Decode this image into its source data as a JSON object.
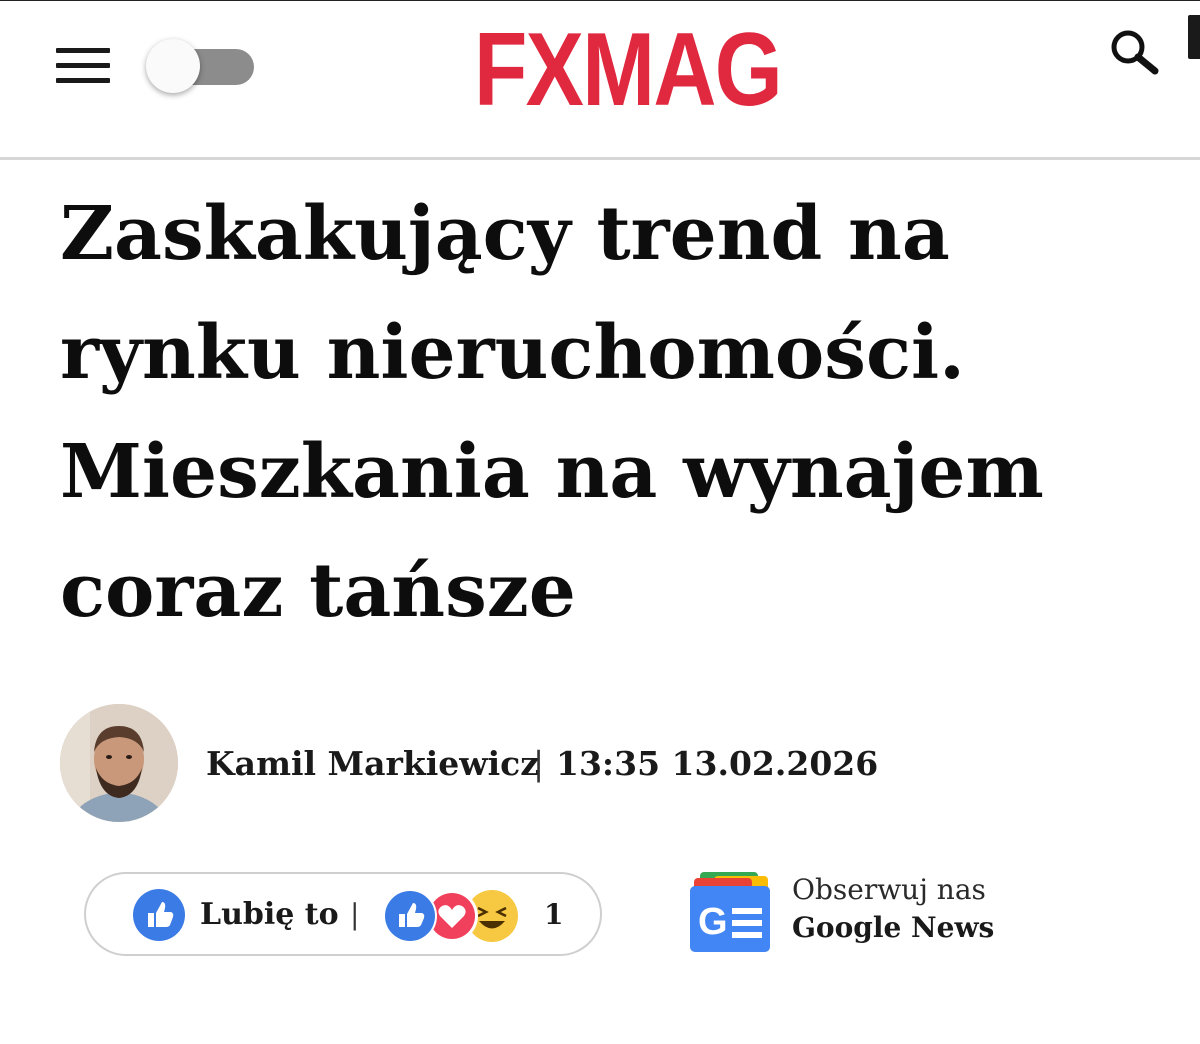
{
  "header": {
    "logo_text": "FXMAG",
    "logo_color": "#e0283f",
    "menu_icon": "hamburger-menu-icon",
    "theme_toggle": "off",
    "search_icon": "search-icon"
  },
  "article": {
    "title": "Zaskakujący trend na rynku nieruchomości. Mieszkania na wynajem coraz tańsze",
    "author": "Kamil Markiewicz",
    "separator": "|",
    "time": "13:35",
    "date": "13.02.2026"
  },
  "reactions": {
    "like_label": "Lubię to",
    "separator": "|",
    "count": "1",
    "icons": [
      "thumbs-up-icon",
      "heart-icon",
      "laugh-emoji-icon"
    ],
    "like_color": "#1877f2",
    "heart_color": "#f0405c",
    "laugh_color": "#f7c842"
  },
  "google_news": {
    "follow_label": "Obserwuj nas",
    "name": "Google News",
    "icon": "google-news-icon"
  }
}
